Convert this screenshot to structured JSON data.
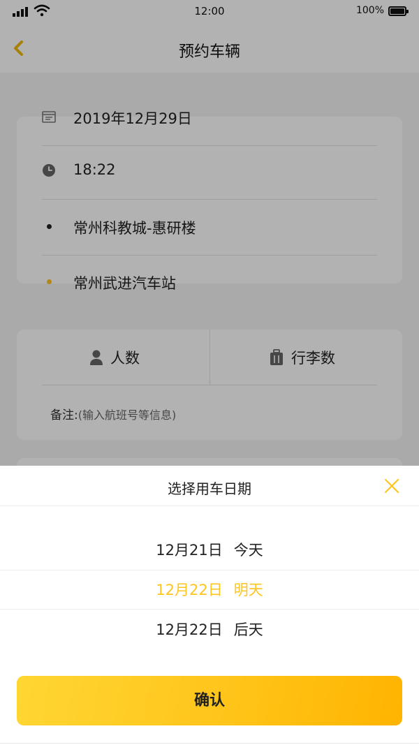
{
  "status_bar": {
    "time": "12:00",
    "battery": "100%"
  },
  "nav": {
    "title": "预约车辆",
    "back_icon": "chevron-left-icon"
  },
  "trip": {
    "date": "2019年12月29日",
    "time": "18:22",
    "origin": "常州科教城-惠研楼",
    "destination": "常州武进汽车站"
  },
  "passengers": {
    "people_label": "人数",
    "luggage_label": "行李数"
  },
  "remark": {
    "label": "备注:",
    "placeholder": "(输入航班号等信息)"
  },
  "date_picker": {
    "title": "选择用车日期",
    "options": [
      {
        "date": "12月21日",
        "day": "今天"
      },
      {
        "date": "12月22日",
        "day": "明天",
        "selected": true
      },
      {
        "date": "12月22日",
        "day": "后天"
      }
    ],
    "confirm_label": "确认"
  },
  "colors": {
    "accent": "#ffc51f",
    "origin_dot": "#222222",
    "destination_dot": "#ffc51f"
  }
}
